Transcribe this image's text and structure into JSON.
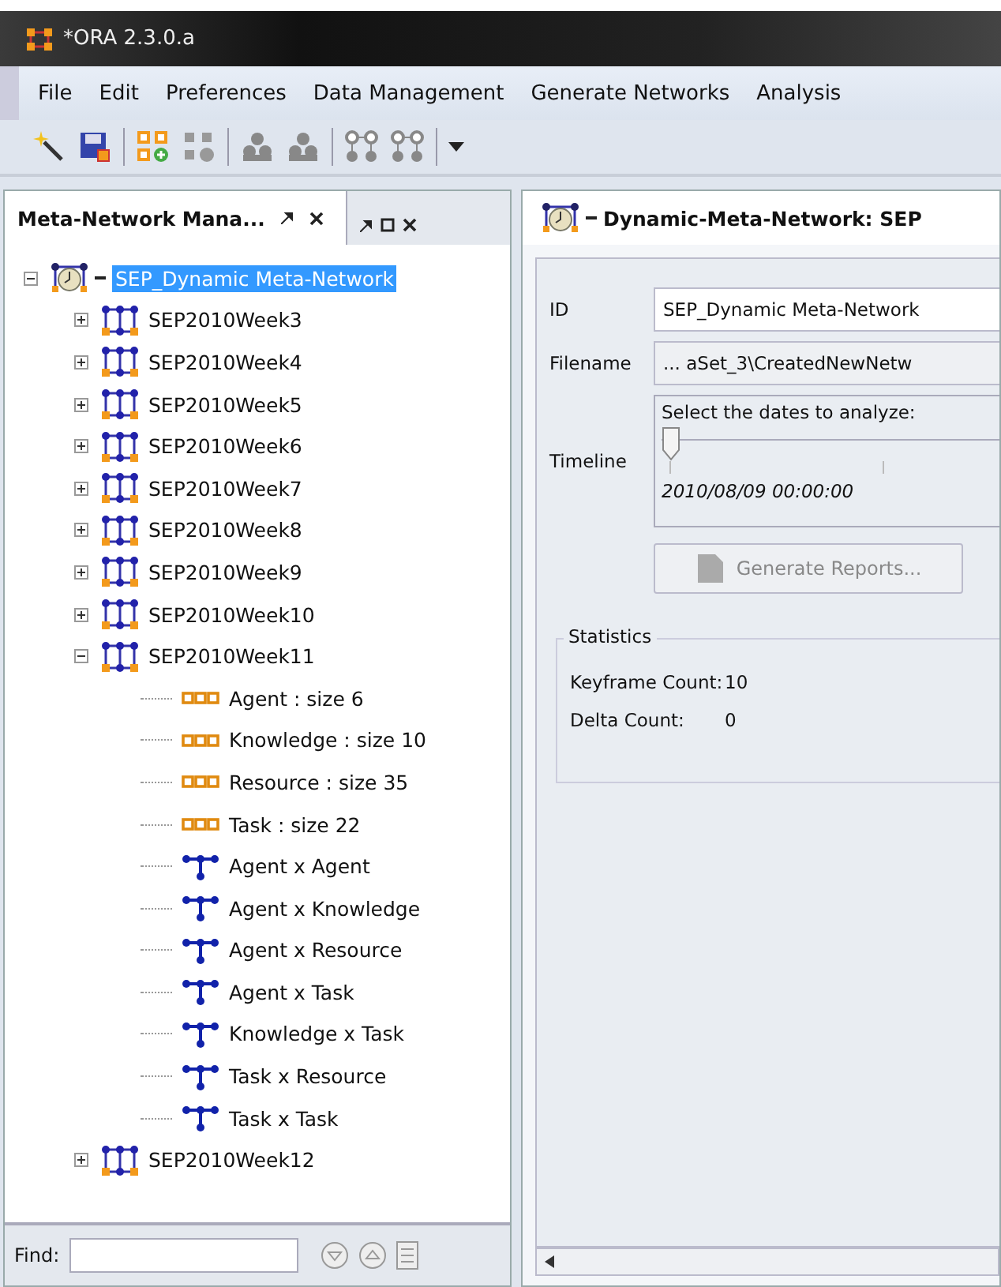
{
  "window": {
    "title": "*ORA 2.3.0.a"
  },
  "menu": [
    "File",
    "Edit",
    "Preferences",
    "Data Management",
    "Generate Networks",
    "Analysis"
  ],
  "left_panel": {
    "title": "Meta-Network Mana...",
    "find": {
      "label": "Find:"
    }
  },
  "tree": [
    {
      "label": "SEP_Dynamic Meta-Network",
      "kind": "dynamic",
      "selected": true,
      "expanded": true,
      "children": [
        {
          "label": "SEP2010Week3",
          "kind": "metanetwork",
          "selected": false,
          "expanded": false
        },
        {
          "label": "SEP2010Week4",
          "kind": "metanetwork",
          "selected": false,
          "expanded": false
        },
        {
          "label": "SEP2010Week5",
          "kind": "metanetwork",
          "selected": false,
          "expanded": false
        },
        {
          "label": "SEP2010Week6",
          "kind": "metanetwork",
          "selected": false,
          "expanded": false
        },
        {
          "label": "SEP2010Week7",
          "kind": "metanetwork",
          "selected": false,
          "expanded": false
        },
        {
          "label": "SEP2010Week8",
          "kind": "metanetwork",
          "selected": false,
          "expanded": false
        },
        {
          "label": "SEP2010Week9",
          "kind": "metanetwork",
          "selected": false,
          "expanded": false
        },
        {
          "label": "SEP2010Week10",
          "kind": "metanetwork",
          "selected": false,
          "expanded": false
        },
        {
          "label": "SEP2010Week11",
          "kind": "metanetwork",
          "selected": false,
          "expanded": true,
          "children": [
            {
              "label": "Agent : size 6",
              "kind": "nodeset",
              "selected": false
            },
            {
              "label": "Knowledge : size 10",
              "kind": "nodeset",
              "selected": false
            },
            {
              "label": "Resource : size 35",
              "kind": "nodeset",
              "selected": false
            },
            {
              "label": "Task : size 22",
              "kind": "nodeset",
              "selected": false
            },
            {
              "label": "Agent x Agent",
              "kind": "network",
              "selected": false
            },
            {
              "label": "Agent x Knowledge",
              "kind": "network",
              "selected": false
            },
            {
              "label": "Agent x Resource",
              "kind": "network",
              "selected": false
            },
            {
              "label": "Agent x Task",
              "kind": "network",
              "selected": false
            },
            {
              "label": "Knowledge x Task",
              "kind": "network",
              "selected": false
            },
            {
              "label": "Task x Resource",
              "kind": "network",
              "selected": false
            },
            {
              "label": "Task x Task",
              "kind": "network",
              "selected": false
            }
          ]
        },
        {
          "label": "SEP2010Week12",
          "kind": "metanetwork",
          "selected": false,
          "expanded": false
        }
      ]
    }
  ],
  "right_panel": {
    "title": "Dynamic-Meta-Network: SEP",
    "id": {
      "label": "ID",
      "value": "SEP_Dynamic Meta-Network"
    },
    "filename": {
      "label": "Filename",
      "value": "... aSet_3\\CreatedNewNetw"
    },
    "timeline": {
      "label": "Timeline",
      "prompt": "Select the dates to analyze:",
      "level": 0,
      "date": "2010/08/09 00:00:00"
    },
    "generate_button": {
      "label": "Generate Reports...",
      "disabled": true
    },
    "statistics": {
      "title": "Statistics",
      "rows": [
        {
          "label": "Keyframe Count:",
          "value": "10"
        },
        {
          "label": "Delta Count:",
          "value": "0"
        }
      ]
    }
  }
}
